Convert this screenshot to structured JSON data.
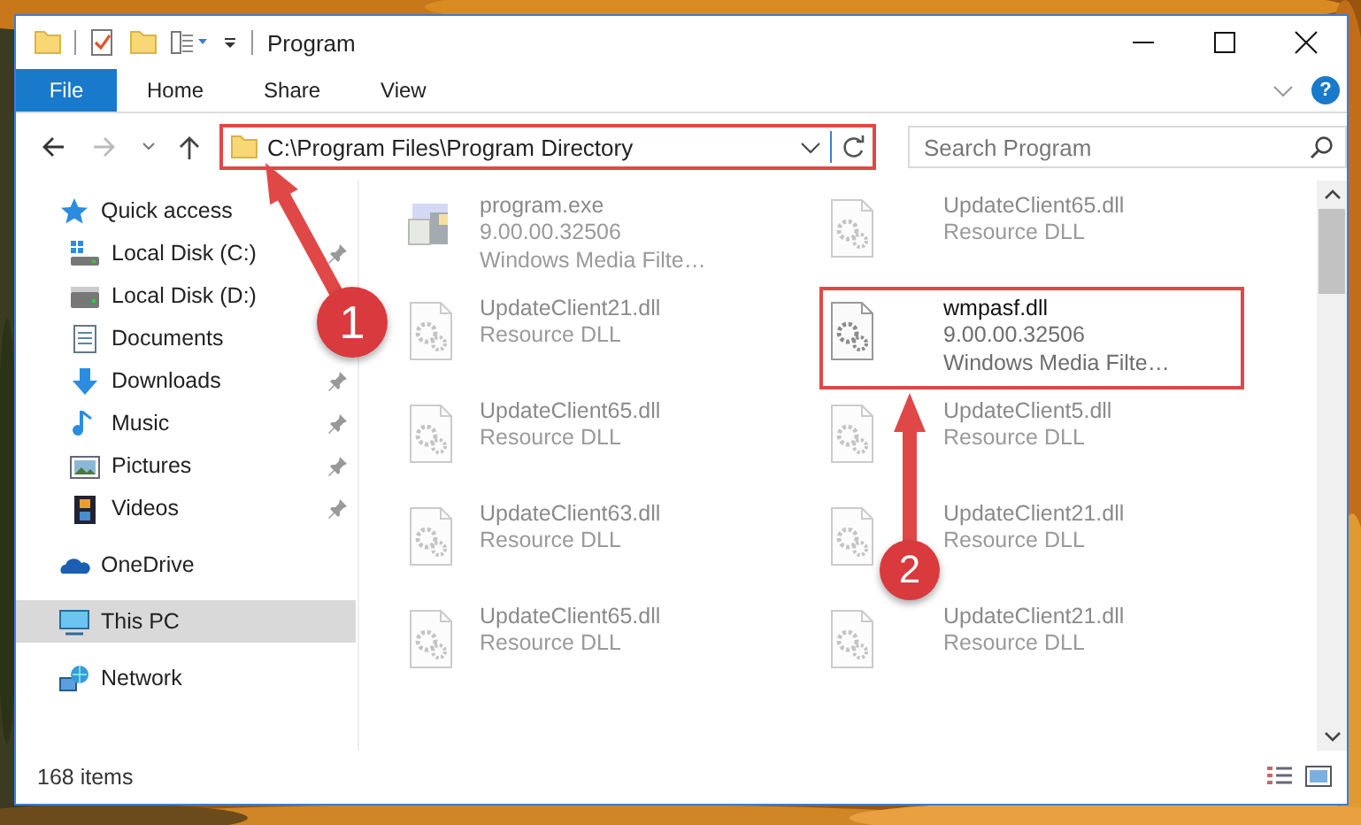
{
  "window": {
    "title": "Program"
  },
  "ribbon": {
    "tabs": [
      {
        "label": "File",
        "kind": "file"
      },
      {
        "label": "Home",
        "kind": "tab"
      },
      {
        "label": "Share",
        "kind": "tab"
      },
      {
        "label": "View",
        "kind": "tab"
      }
    ],
    "help": "?"
  },
  "address": {
    "path": "C:\\Program Files\\Program Directory",
    "highlighted": true
  },
  "search": {
    "placeholder": "Search Program"
  },
  "navigation": [
    {
      "label": "Quick access",
      "kind": "quick",
      "selected": false,
      "children": [
        {
          "label": "Local Disk (C:)",
          "kind": "disk-c",
          "pinned": true,
          "selected": false
        },
        {
          "label": "Local Disk (D:)",
          "kind": "disk",
          "selected": false
        },
        {
          "label": "Documents",
          "kind": "documents",
          "selected": false
        },
        {
          "label": "Downloads",
          "kind": "downloads",
          "pinned": true,
          "selected": false
        },
        {
          "label": "Music",
          "kind": "music",
          "pinned": true,
          "selected": false
        },
        {
          "label": "Pictures",
          "kind": "pictures",
          "pinned": true,
          "selected": false
        },
        {
          "label": "Videos",
          "kind": "videos",
          "pinned": true,
          "selected": false
        }
      ]
    },
    {
      "label": "OneDrive",
      "kind": "onedrive",
      "selected": false
    },
    {
      "label": "This PC",
      "kind": "pc",
      "selected": true
    },
    {
      "label": "Network",
      "kind": "network",
      "selected": false
    }
  ],
  "files": [
    {
      "name": "program.exe",
      "kind": "exe",
      "details": [
        "9.00.00.32506",
        "Windows Media Filte…"
      ],
      "blurred": true,
      "highlighted": false
    },
    {
      "name": "UpdateClient65.dll",
      "kind": "dll",
      "details": [
        "Resource DLL"
      ],
      "blurred": true,
      "highlighted": false
    },
    {
      "name": "UpdateClient21.dll",
      "kind": "dll",
      "details": [
        "Resource DLL"
      ],
      "blurred": true,
      "highlighted": false
    },
    {
      "name": "wmpasf.dll",
      "kind": "dll",
      "details": [
        "9.00.00.32506",
        "Windows Media Filte…"
      ],
      "blurred": false,
      "highlighted": true
    },
    {
      "name": "UpdateClient65.dll",
      "kind": "dll",
      "details": [
        "Resource DLL"
      ],
      "blurred": true,
      "highlighted": false
    },
    {
      "name": "UpdateClient5.dll",
      "kind": "dll",
      "details": [
        "Resource DLL"
      ],
      "blurred": true,
      "highlighted": false
    },
    {
      "name": "UpdateClient63.dll",
      "kind": "dll",
      "details": [
        "Resource DLL"
      ],
      "blurred": true,
      "highlighted": false
    },
    {
      "name": "UpdateClient21.dll",
      "kind": "dll",
      "details": [
        "Resource DLL"
      ],
      "blurred": true,
      "highlighted": false
    },
    {
      "name": "UpdateClient65.dll",
      "kind": "dll",
      "details": [
        "Resource DLL"
      ],
      "blurred": true,
      "highlighted": false
    },
    {
      "name": "UpdateClient21.dll",
      "kind": "dll",
      "details": [
        "Resource DLL"
      ],
      "blurred": true,
      "highlighted": false
    }
  ],
  "callouts": [
    {
      "number": "1"
    },
    {
      "number": "2"
    }
  ],
  "status_bar": {
    "item_count": "168 items"
  }
}
